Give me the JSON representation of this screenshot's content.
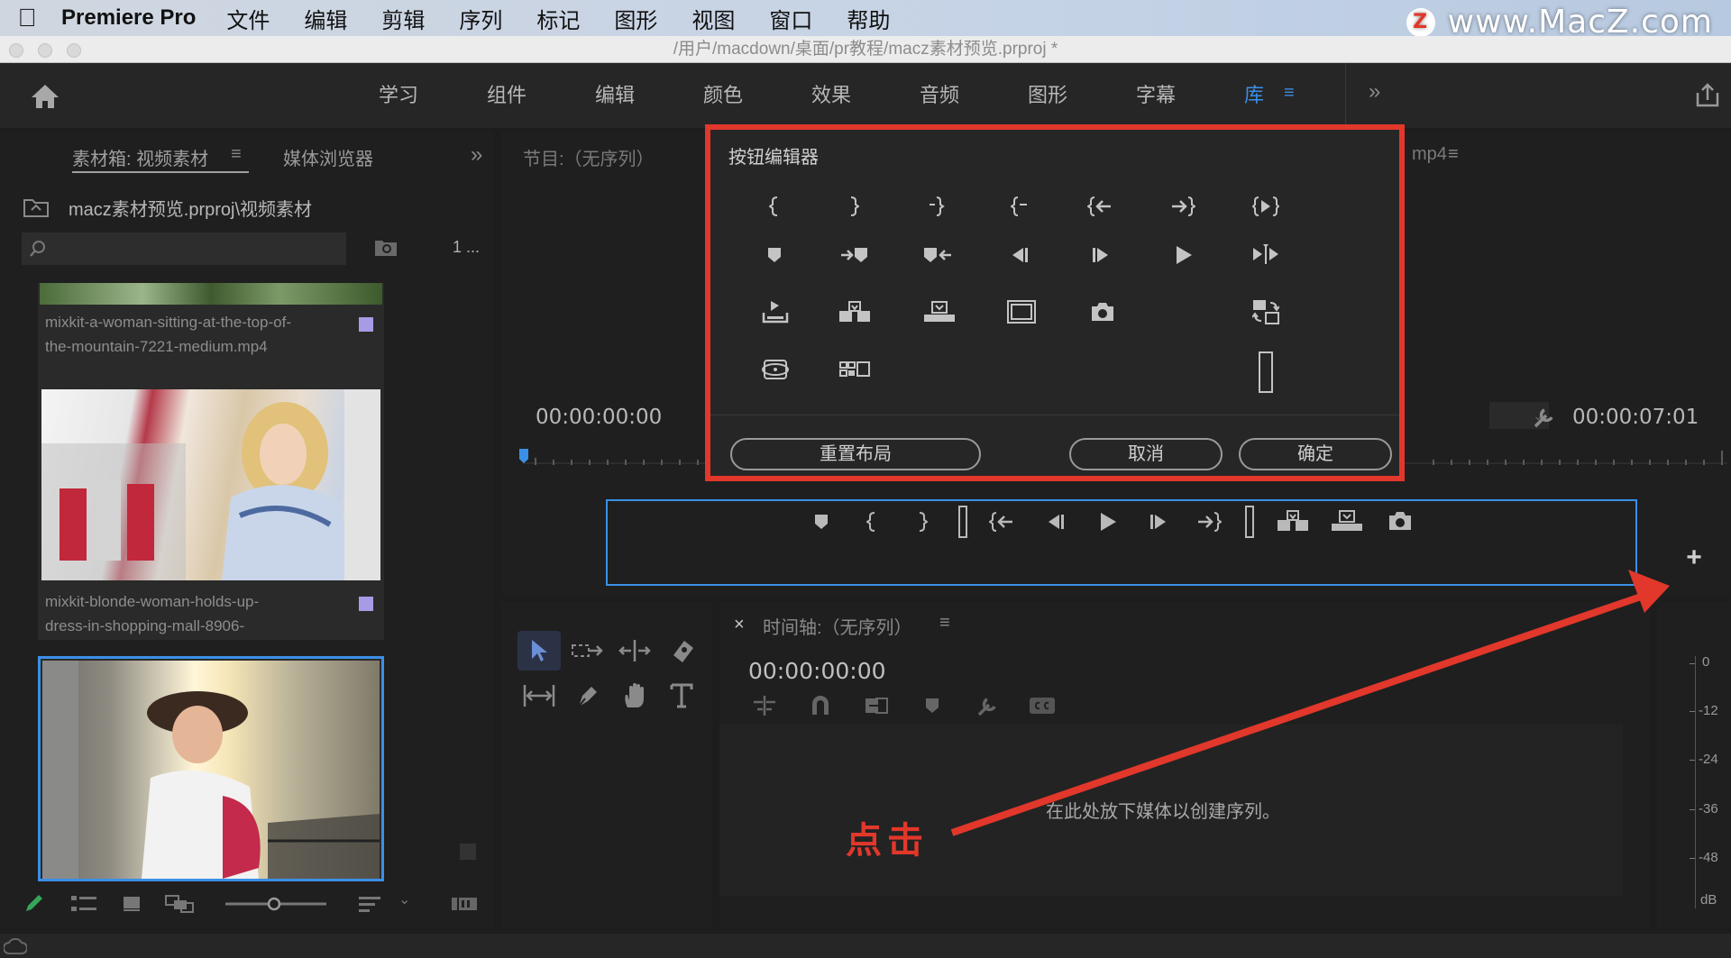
{
  "menubar": {
    "app_name": "Premiere Pro",
    "items": [
      "文件",
      "编辑",
      "剪辑",
      "序列",
      "标记",
      "图形",
      "视图",
      "窗口",
      "帮助"
    ],
    "watermark": "www.MacZ.com",
    "watermark_badge": "Z"
  },
  "window": {
    "title": "/用户/macdown/桌面/pr教程/macz素材预览.prproj *"
  },
  "workspace": {
    "tabs": [
      "学习",
      "组件",
      "编辑",
      "颜色",
      "效果",
      "音频",
      "图形",
      "字幕",
      "库"
    ],
    "active_tab": "库"
  },
  "project_panel": {
    "tab_active": "素材箱: 视频素材",
    "tab_other": "媒体浏览器",
    "path": "macz素材预览.prproj\\视频素材",
    "count": "1 ...",
    "clips": [
      {
        "name_line1": "mixkit-a-woman-sitting-at-the-top-of-",
        "name_line2": "the-mountain-7221-medium.mp4"
      },
      {
        "name_line1": "mixkit-blonde-woman-holds-up-",
        "name_line2": "dress-in-shopping-mall-8906-"
      }
    ]
  },
  "program_monitor": {
    "tab_label": "节目:（无序列）",
    "source_tab_suffix": "mp4",
    "timecode_left": "00:00:00:00",
    "timecode_right": "00:00:07:01"
  },
  "button_editor": {
    "title": "按钮编辑器",
    "reset_label": "重置布局",
    "cancel_label": "取消",
    "ok_label": "确定"
  },
  "timeline_panel": {
    "close": "×",
    "tab_label": "时间轴:（无序列）",
    "timecode": "00:00:00:00",
    "drop_hint": "在此处放下媒体以创建序列。"
  },
  "annotation": {
    "text": "点击",
    "color": "#e2372b"
  },
  "audio_meter": {
    "labels": [
      "0",
      "-12",
      "-24",
      "-36",
      "-48",
      "dB"
    ]
  },
  "colors": {
    "accent_blue": "#3b8fe6",
    "annotation_red": "#e2372b",
    "clip_label_lavender": "#a79be6"
  }
}
